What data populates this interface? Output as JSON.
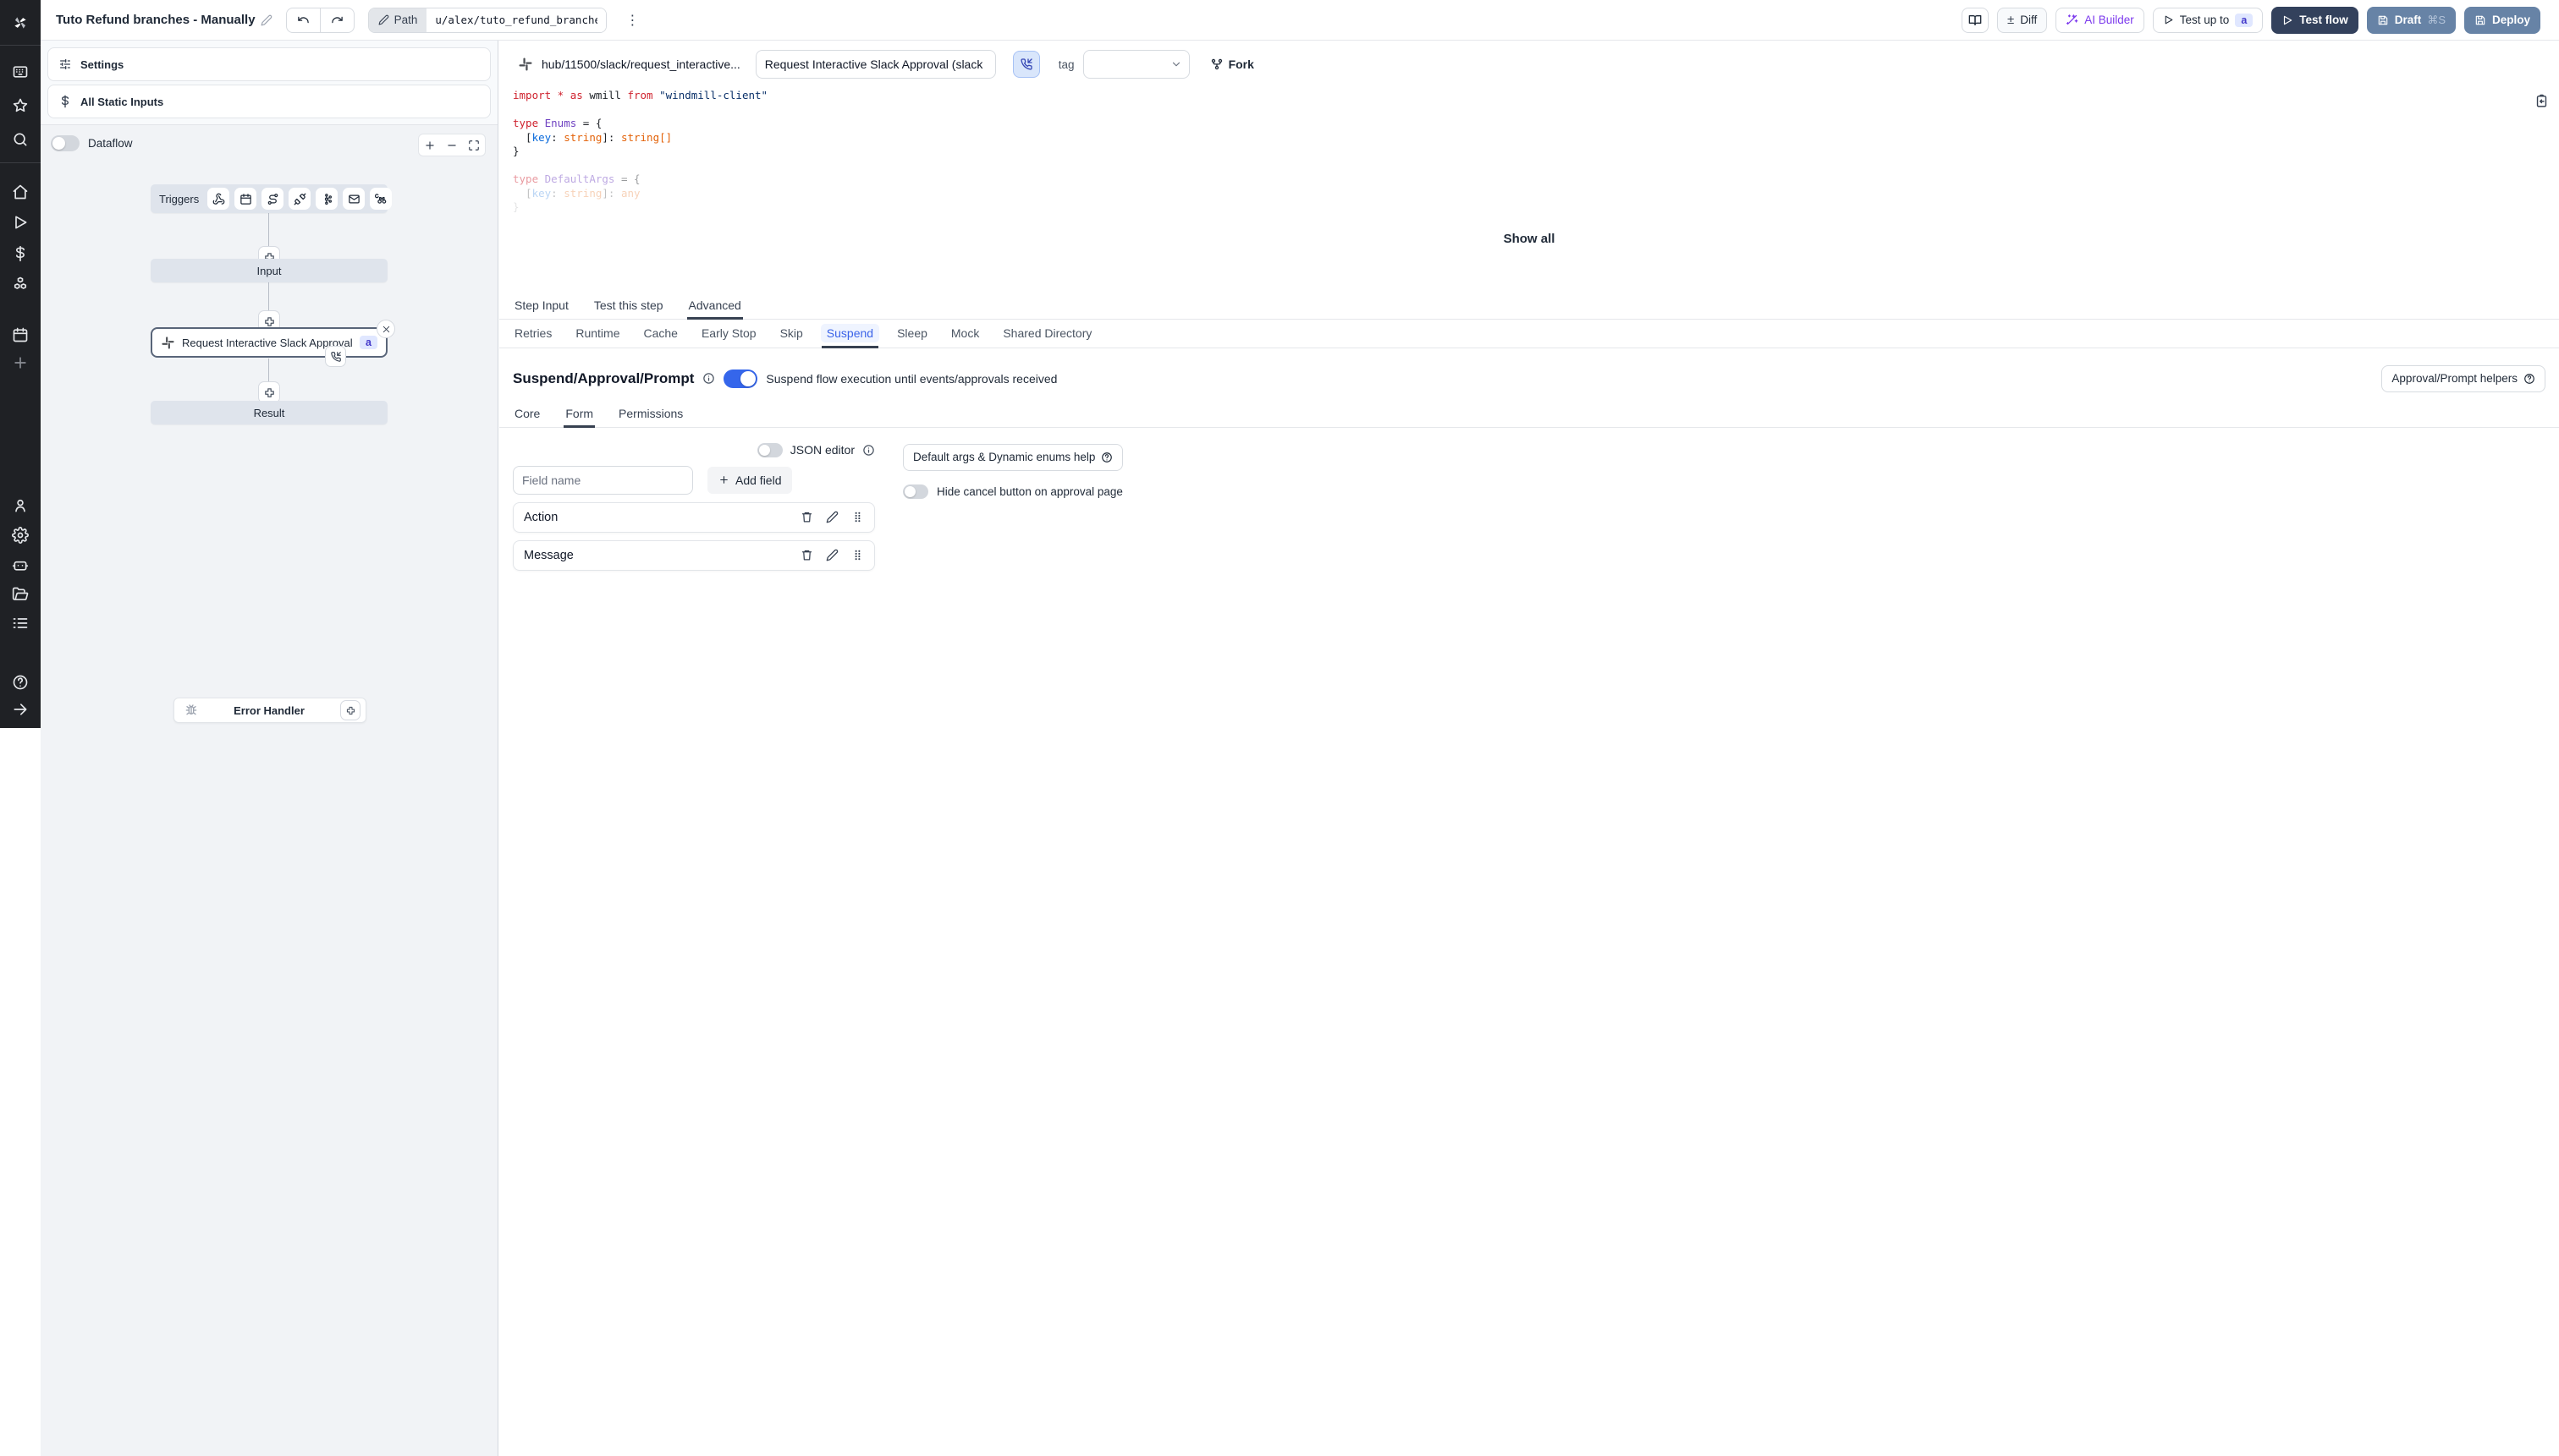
{
  "colors": {
    "accent_blue": "#3566eb",
    "test_flow_bg": "#33415c",
    "draft_deploy_bg": "#6783a6",
    "ai_builder_purple": "#7c3aed",
    "badge_bg": "#e0e7ff",
    "badge_text": "#4338ca",
    "suspend_tab_blue": "#3b63e8",
    "sidebar_bg": "#1f2125",
    "node_fill": "#dfe4ec",
    "canvas_bg": "#f1f3f6"
  },
  "icons": {
    "kebab": "⋮",
    "diff_plusminus": "±",
    "draft_shortcut": "⌘S"
  },
  "topbar": {
    "title": "Tuto Refund branches - Manually",
    "path_label": "Path",
    "path_value": "u/alex/tuto_refund_branches_",
    "diff_label": "Diff",
    "ai_builder_label": "AI Builder",
    "test_up_to_label": "Test up to",
    "test_up_to_badge": "a",
    "test_flow_label": "Test flow",
    "draft_label": "Draft",
    "deploy_label": "Deploy"
  },
  "left_panel": {
    "settings_label": "Settings",
    "all_static_inputs_label": "All Static Inputs",
    "dataflow_label": "Dataflow",
    "graph": {
      "triggers_label": "Triggers",
      "input_label": "Input",
      "step_label": "Request Interactive Slack Approval (...",
      "step_badge": "a",
      "result_label": "Result",
      "error_handler_label": "Error Handler"
    }
  },
  "right_panel": {
    "header": {
      "hub_path": "hub/11500/slack/request_interactive...",
      "summary_value": "Request Interactive Slack Approval (slack",
      "tag_label": "tag",
      "fork_label": "Fork"
    },
    "code": {
      "line1": {
        "kw_import": "import",
        "star": " * ",
        "kw_as": "as",
        "id_wmill": " wmill ",
        "kw_from": "from",
        "str_client": " \"windmill-client\""
      },
      "line3": {
        "kw_type": "type",
        "id_enums": " Enums",
        "eq": " = {"
      },
      "line4": {
        "br1": "  [",
        "id_key": "key",
        "c1": ": ",
        "ty1": "string",
        "br2": "]: ",
        "ty2": "string[]"
      },
      "line5": {
        "brace": "}"
      },
      "line7": {
        "kw_type": "type",
        "id_args": " DefaultArgs",
        "eq": " = {"
      },
      "line8": {
        "br1": "  [",
        "id_key": "key",
        "c1": ": ",
        "ty1": "string",
        "br2": "]: ",
        "ty2": "any"
      },
      "line9": {
        "brace": "}"
      }
    },
    "show_all_label": "Show all",
    "tabs": [
      "Step Input",
      "Test this step",
      "Advanced"
    ],
    "sub_tabs": [
      "Retries",
      "Runtime",
      "Cache",
      "Early Stop",
      "Skip",
      "Suspend",
      "Sleep",
      "Mock",
      "Shared Directory"
    ],
    "suspend": {
      "heading": "Suspend/Approval/Prompt",
      "toggle_description": "Suspend flow execution until events/approvals received",
      "helpers_button": "Approval/Prompt helpers",
      "tabs": [
        "Core",
        "Form",
        "Permissions"
      ],
      "form": {
        "json_editor_label": "JSON editor",
        "field_name_placeholder": "Field name",
        "add_field_label": "Add field",
        "fields": [
          "Action",
          "Message"
        ],
        "default_args_help_label": "Default args & Dynamic enums help",
        "hide_cancel_label": "Hide cancel button on approval page"
      }
    }
  }
}
